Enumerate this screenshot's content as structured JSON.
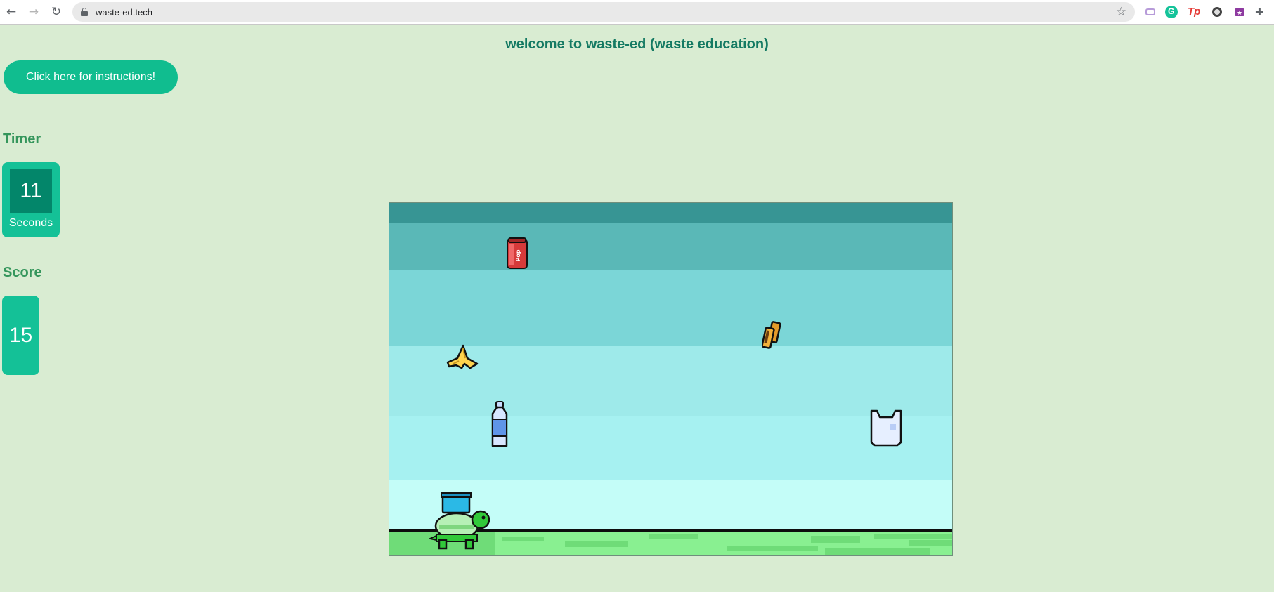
{
  "browser": {
    "url": "waste-ed.tech",
    "back_icon": "←",
    "forward_icon": "→",
    "reload_icon": "↻",
    "star_icon": "☆",
    "extensions": [
      "robot-extension-icon",
      "grammarly-icon",
      "tp-extension-icon",
      "circle-extension-icon",
      "star-box-extension-icon",
      "puzzle-icon"
    ],
    "tp_label": "Tp"
  },
  "page": {
    "welcome": "welcome to waste-ed (waste education)",
    "instructions_button": "Click here for instructions!"
  },
  "timer": {
    "label": "Timer",
    "value": "11",
    "unit": "Seconds"
  },
  "score": {
    "label": "Score",
    "value": "15"
  },
  "game": {
    "can_text": "Pop",
    "items": [
      "soda-can",
      "battery",
      "banana-peel",
      "plastic-bottle",
      "plastic-bag",
      "turtle-player"
    ]
  },
  "colors": {
    "background": "#d9ecd2",
    "accent": "#10bd8f",
    "dark_accent": "#03866a",
    "heading": "#147a63"
  }
}
